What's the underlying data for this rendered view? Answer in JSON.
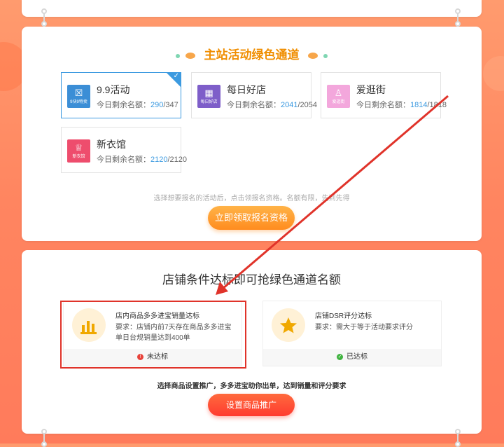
{
  "top_card": {},
  "channel": {
    "title": "主站活动绿色通道",
    "activities": [
      {
        "name": "9.9活动",
        "icon_text": "9块9特卖",
        "icon_glyph": "☒",
        "quota_label": "今日剩余名额：",
        "remaining": "290",
        "total": "/347",
        "color": "#3b8ed6",
        "selected": true
      },
      {
        "name": "每日好店",
        "icon_text": "每日好店",
        "icon_glyph": "▦",
        "quota_label": "今日剩余名额：",
        "remaining": "2041",
        "total": "/2054",
        "color": "#7e5ec9",
        "selected": false
      },
      {
        "name": "爱逛街",
        "icon_text": "爱逛街",
        "icon_glyph": "♙",
        "quota_label": "今日剩余名额：",
        "remaining": "1814",
        "total": "/1818",
        "color": "#f3a7dc",
        "selected": false
      },
      {
        "name": "新衣馆",
        "icon_text": "新衣馆",
        "icon_glyph": "♕",
        "quota_label": "今日剩余名额：",
        "remaining": "2120",
        "total": "/2120",
        "color": "#ee4d6d",
        "selected": false
      }
    ],
    "hint": "选择想要报名的活动后，点击领报名资格。名额有限，先到先得",
    "claim_button": "立即领取报名资格"
  },
  "conditions": {
    "title": "店铺条件达标即可抢绿色通道名额",
    "items": [
      {
        "title": "店内商品多多进宝销量达标",
        "desc": "要求：店铺内前7天存在商品多多进宝单日台规销量达到400单",
        "status": "未达标",
        "status_color": "#e8433b",
        "icon": "bar-chart-icon",
        "status_icon": "!"
      },
      {
        "title": "店铺DSR评分达标",
        "desc": "要求：需大于等于活动要求评分",
        "status": "已达标",
        "status_color": "#3fb33f",
        "icon": "star-icon",
        "status_icon": "✓"
      }
    ],
    "note": "选择商品设置推广，多多进宝助你出单，达到销量和评分要求",
    "promo_button": "设置商品推广"
  },
  "annotation": {
    "arrow_color": "#e0332a"
  }
}
